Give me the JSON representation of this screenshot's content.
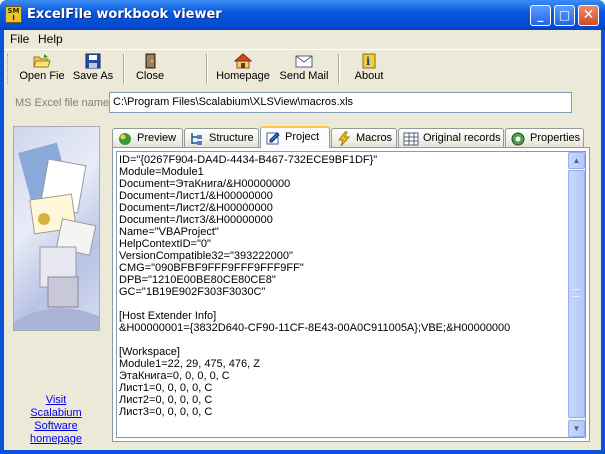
{
  "window": {
    "title": "ExcelFile workbook viewer",
    "app_icon_text": "SM\nI",
    "minimize_glyph": "_",
    "maximize_glyph": "□",
    "close_glyph": "✕"
  },
  "menu": [
    "File",
    "Help"
  ],
  "toolbar": {
    "open_label": "Open Fie",
    "save_as_label": "Save As",
    "close_label": "Close",
    "homepage_label": "Homepage",
    "send_mail_label": "Send Mail",
    "about_label": "About"
  },
  "path": {
    "label": "MS Excel file name:",
    "value": "C:\\Program Files\\Scalabium\\XLSView\\macros.xls"
  },
  "sidebar": {
    "visit_line1": "Visit",
    "visit_line2": "Scalabium Software",
    "visit_line3": "homepage"
  },
  "tabs": [
    {
      "label": "Preview",
      "icon": "preview-icon"
    },
    {
      "label": "Structure",
      "icon": "structure-icon"
    },
    {
      "label": "Project",
      "icon": "project-icon",
      "active": true
    },
    {
      "label": "Macros",
      "icon": "macros-icon"
    },
    {
      "label": "Original records",
      "icon": "records-icon"
    },
    {
      "label": "Properties",
      "icon": "properties-icon"
    }
  ],
  "content": {
    "lines": [
      "ID=\"{0267F904-DA4D-4434-B467-732ECE9BF1DF}\"",
      "Module=Module1",
      "Document=ЭтаКнига/&H00000000",
      "Document=Лист1/&H00000000",
      "Document=Лист2/&H00000000",
      "Document=Лист3/&H00000000",
      "Name=\"VBAProject\"",
      "HelpContextID=\"0\"",
      "VersionCompatible32=\"393222000\"",
      "CMG=\"090BFBF9FFF9FFF9FFF9FF\"",
      "DPB=\"1210E00BE80CE80CE8\"",
      "GC=\"1B19E902F303F3030C\"",
      "",
      "[Host Extender Info]",
      "&H00000001={3832D640-CF90-11CF-8E43-00A0C911005A};VBE;&H00000000",
      "",
      "[Workspace]",
      "Module1=22, 29, 475, 476, Z",
      "ЭтаКнига=0, 0, 0, 0, C",
      "Лист1=0, 0, 0, 0, C",
      "Лист2=0, 0, 0, 0, C",
      "Лист3=0, 0, 0, 0, C"
    ]
  },
  "scrollbar": {
    "up_glyph": "▲",
    "down_glyph": "▼"
  },
  "colors": {
    "titlebar": "#0a5ade",
    "face": "#ece9d8",
    "link": "#0000ee",
    "active_tab_accent": "#ffc83c"
  }
}
